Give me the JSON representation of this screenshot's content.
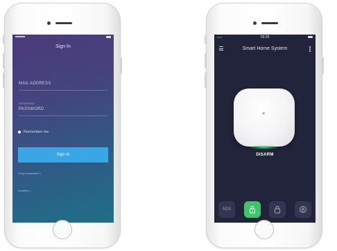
{
  "colors": {
    "signin_gradient_top": "#4c3a7a",
    "signin_gradient_bottom": "#1f6f88",
    "signin_button": "#3aa6e6",
    "home_background": "#21243a",
    "active_action": "#3ec46a"
  },
  "signin": {
    "title": "Sign In",
    "email_label": "MAIL ADDRESS",
    "password_small_label": "PASSWORD",
    "password_label": "PASSWORD",
    "remember_label": "Remember me",
    "signin_button": "Sign In",
    "forgot_link": "Forgot password >",
    "location_link": "Location >"
  },
  "home": {
    "status_time": "09:28",
    "status_carrier": "•••••",
    "title": "Smart Home System",
    "status": "DISARM",
    "actions": [
      {
        "label": "SOS",
        "icon": "sos-icon"
      },
      {
        "label": "",
        "icon": "unlock-icon",
        "active": true
      },
      {
        "label": "",
        "icon": "lock-icon"
      },
      {
        "label": "",
        "icon": "home-lock-icon"
      }
    ]
  }
}
